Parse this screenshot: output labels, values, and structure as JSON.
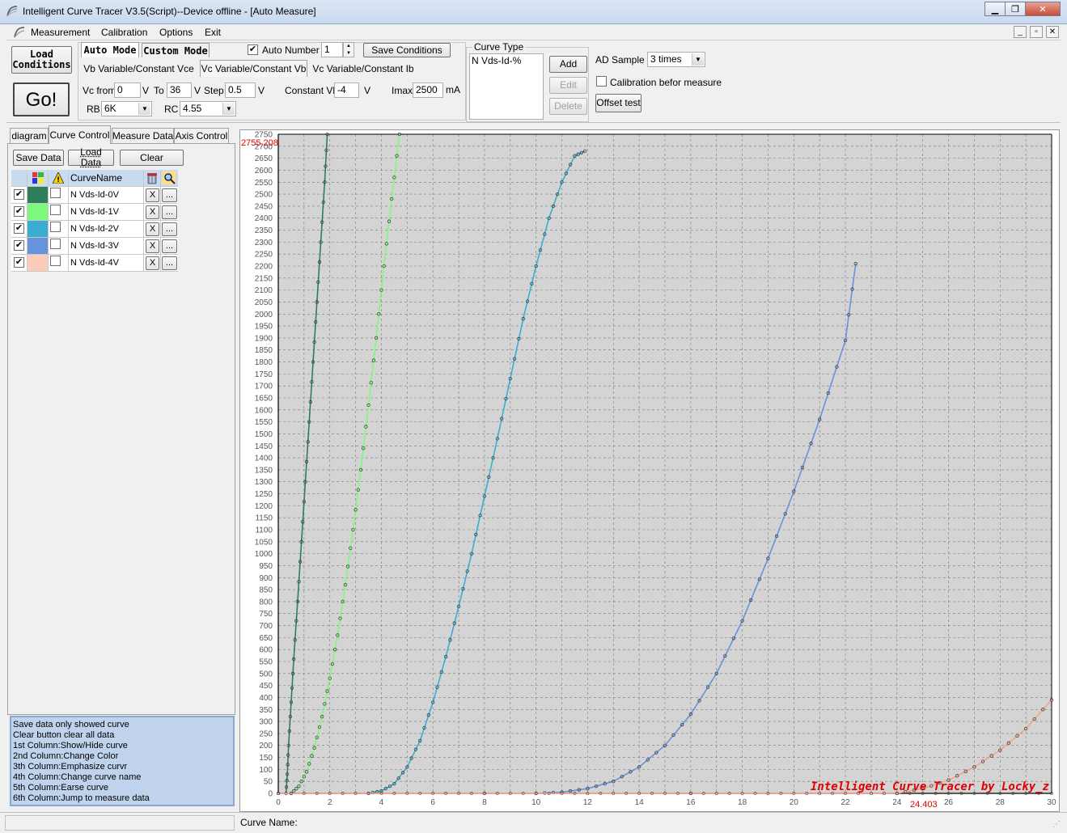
{
  "window": {
    "title": "Intelligent Curve Tracer V3.5(Script)--Device offline - [Auto Measure]",
    "controls": [
      "▁",
      "❐",
      "✕"
    ]
  },
  "menu": {
    "items": [
      "Measurement",
      "Calibration",
      "Options",
      "Exit"
    ],
    "mdi_controls": [
      "_",
      "▫",
      "✕"
    ]
  },
  "toolbar": {
    "load_conditions": "Load Conditions",
    "go": "Go!",
    "modes": [
      "Auto Mode",
      "Custom Mode"
    ],
    "sub_modes": [
      "Vb Variable/Constant Vce",
      "Vc Variable/Constant Vb",
      "Vc Variable/Constant Ib"
    ],
    "vc_from_label": "Vc from",
    "vc_from": "0",
    "v1": "V",
    "to_label": "To",
    "to": "36",
    "v2": "V",
    "step_label": "Step",
    "step": "0.5",
    "v3": "V",
    "constant_vb_label": "Constant Vb",
    "constant_vb": "-4",
    "v4": "V",
    "imax_label": "Imax",
    "imax": "2500",
    "ma": "mA",
    "rb_label": "RB",
    "rb": "6K",
    "rc_label": "RC",
    "rc": "4.55",
    "auto_number_label": "Auto Number",
    "auto_number_checked": "✔",
    "auto_number": "1",
    "save_conditions": "Save Conditions",
    "curve_type_label": "Curve Type",
    "curve_type_item": "N Vds-Id-%",
    "add": "Add",
    "edit": "Edit",
    "delete": "Delete",
    "ad_sample_label": "AD Sample",
    "ad_sample": "3 times",
    "calibration_label": "Calibration befor measure",
    "offset_test": "Offset test"
  },
  "left_tabs": [
    "diagram",
    "Curve Control",
    "Measure Data",
    "Axis Control"
  ],
  "curve_control": {
    "save_data": "Save Data",
    "load_data": "Load Data",
    "clear": "Clear",
    "header_name": "CurveName",
    "check_mark": "✔",
    "erase_label": "X",
    "jump_label": "...",
    "rows": [
      {
        "name": "N Vds-Id-0V",
        "color": "#2e7d5b"
      },
      {
        "name": "N Vds-Id-1V",
        "color": "#7dfa7d"
      },
      {
        "name": "N Vds-Id-2V",
        "color": "#3aaed0"
      },
      {
        "name": "N Vds-Id-3V",
        "color": "#6693db"
      },
      {
        "name": "N Vds-Id-4V",
        "color": "#f9cdb9"
      }
    ]
  },
  "help_lines": [
    "  Save data only showed curve",
    "  Clear button clear all data",
    "1st Column:Show/Hide curve",
    "2nd Column:Change Color",
    "3th Column:Emphasize curvr",
    "4th Column:Change curve name",
    "5th Column:Earse curve",
    "6th Column:Jump to measure data"
  ],
  "status": {
    "curve_name_label": "Curve Name:"
  },
  "chart_data": {
    "type": "line",
    "title": "",
    "xlabel": "",
    "ylabel": "",
    "xlim": [
      0,
      30
    ],
    "ylim": [
      0,
      2750
    ],
    "x_ticks": [
      0,
      2,
      4,
      6,
      8,
      10,
      12,
      14,
      16,
      18,
      20,
      22,
      24,
      26,
      28,
      30
    ],
    "y_step": 50,
    "grid": true,
    "cursor_y_label": "2755.208",
    "cursor_x_label": "24.403",
    "watermark": "Intelligent Curve Tracer by Locky_z",
    "background": "#d4d4d4",
    "series": [
      {
        "name": "N Vds-Id-0V",
        "color": "#2e7d5b",
        "points": [
          [
            0.3,
            0
          ],
          [
            0.35,
            80
          ],
          [
            0.4,
            200
          ],
          [
            0.5,
            380
          ],
          [
            0.6,
            560
          ],
          [
            0.75,
            800
          ],
          [
            0.9,
            1050
          ],
          [
            1.05,
            1300
          ],
          [
            1.2,
            1550
          ],
          [
            1.35,
            1800
          ],
          [
            1.5,
            2050
          ],
          [
            1.65,
            2300
          ],
          [
            1.8,
            2550
          ],
          [
            1.9,
            2750
          ]
        ]
      },
      {
        "name": "N Vds-Id-1V",
        "color": "#7dfa7d",
        "points": [
          [
            0.5,
            0
          ],
          [
            0.8,
            30
          ],
          [
            1.1,
            90
          ],
          [
            1.4,
            190
          ],
          [
            1.7,
            320
          ],
          [
            2.0,
            480
          ],
          [
            2.3,
            660
          ],
          [
            2.6,
            870
          ],
          [
            2.9,
            1100
          ],
          [
            3.2,
            1350
          ],
          [
            3.5,
            1620
          ],
          [
            3.8,
            1900
          ],
          [
            4.1,
            2200
          ],
          [
            4.4,
            2480
          ],
          [
            4.7,
            2750
          ]
        ]
      },
      {
        "name": "N Vds-Id-2V",
        "color": "#3aaed0",
        "points": [
          [
            3.5,
            0
          ],
          [
            4.0,
            10
          ],
          [
            4.5,
            40
          ],
          [
            5.0,
            110
          ],
          [
            5.5,
            220
          ],
          [
            6.0,
            380
          ],
          [
            6.5,
            570
          ],
          [
            7.0,
            780
          ],
          [
            7.5,
            1000
          ],
          [
            8.0,
            1240
          ],
          [
            8.5,
            1480
          ],
          [
            9.0,
            1730
          ],
          [
            9.5,
            1980
          ],
          [
            10.0,
            2200
          ],
          [
            10.5,
            2400
          ],
          [
            11.0,
            2550
          ],
          [
            11.5,
            2660
          ],
          [
            11.9,
            2680
          ]
        ]
      },
      {
        "name": "N Vds-Id-3V",
        "color": "#6693db",
        "points": [
          [
            10,
            0
          ],
          [
            11,
            5
          ],
          [
            12,
            20
          ],
          [
            13,
            50
          ],
          [
            14,
            110
          ],
          [
            15,
            200
          ],
          [
            16,
            330
          ],
          [
            17,
            500
          ],
          [
            18,
            720
          ],
          [
            19,
            980
          ],
          [
            20,
            1260
          ],
          [
            21,
            1560
          ],
          [
            22,
            1890
          ],
          [
            22.4,
            2210
          ]
        ]
      },
      {
        "name": "N Vds-Id-4V",
        "color": "#f4a38a",
        "points": [
          [
            0,
            0
          ],
          [
            24,
            0
          ],
          [
            25,
            20
          ],
          [
            26,
            55
          ],
          [
            27,
            110
          ],
          [
            28,
            180
          ],
          [
            29,
            270
          ],
          [
            30,
            390
          ]
        ]
      }
    ]
  }
}
